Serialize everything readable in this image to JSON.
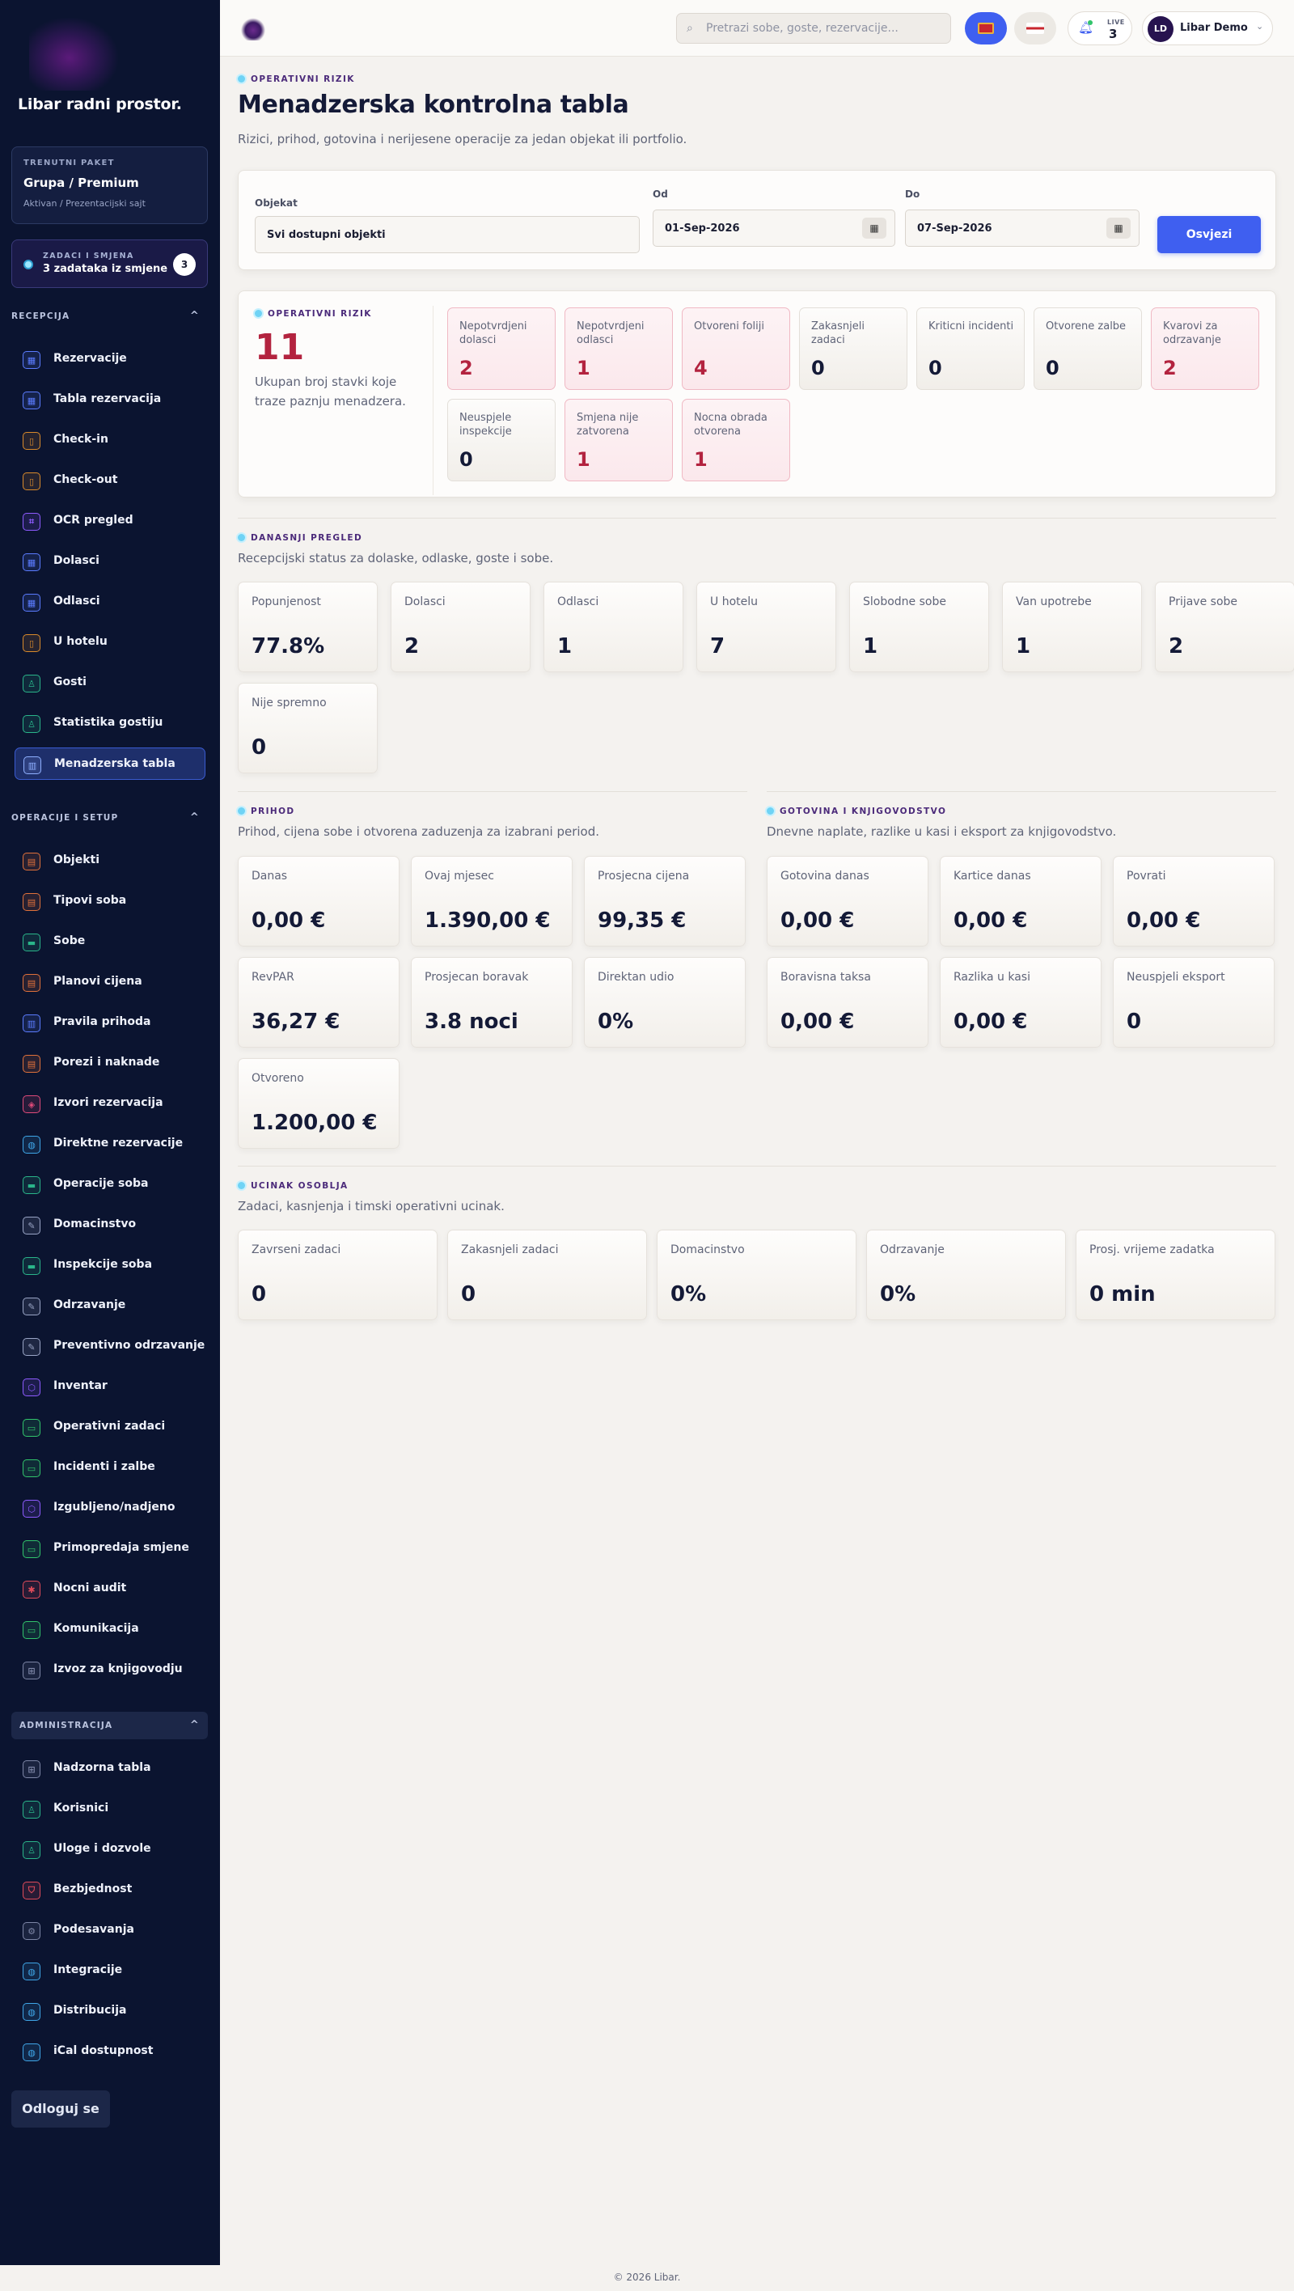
{
  "sidebar": {
    "brand": "Libar radni prostor.",
    "plan": {
      "label": "TRENUTNI PAKET",
      "name": "Grupa / Premium",
      "status": "Aktivan / Prezentacijski sajt"
    },
    "tasks": {
      "label": "ZADACI I SMJENA",
      "text": "3 zadataka iz smjene",
      "count": "3"
    },
    "sections": {
      "reception": "RECEPCIJA",
      "operations": "OPERACIJE I SETUP",
      "admin": "ADMINISTRACIJA"
    },
    "reception_items": [
      {
        "label": "Rezervacije",
        "icon": "calendar-icon",
        "color": "#5b7cff"
      },
      {
        "label": "Tabla rezervacija",
        "icon": "calendar-icon",
        "color": "#5b7cff"
      },
      {
        "label": "Check-in",
        "icon": "door-icon",
        "color": "#d98a2b"
      },
      {
        "label": "Check-out",
        "icon": "door-icon",
        "color": "#d98a2b"
      },
      {
        "label": "OCR pregled",
        "icon": "scan-icon",
        "color": "#8e5bff"
      },
      {
        "label": "Dolasci",
        "icon": "calendar-icon",
        "color": "#5b7cff"
      },
      {
        "label": "Odlasci",
        "icon": "calendar-icon",
        "color": "#5b7cff"
      },
      {
        "label": "U hotelu",
        "icon": "door-icon",
        "color": "#d98a2b"
      },
      {
        "label": "Gosti",
        "icon": "user-icon",
        "color": "#2ab58a"
      },
      {
        "label": "Statistika gostiju",
        "icon": "user-icon",
        "color": "#2ab58a"
      },
      {
        "label": "Menadzerska tabla",
        "icon": "chart-icon",
        "color": "#8fb0ff"
      }
    ],
    "operations_items": [
      {
        "label": "Objekti",
        "icon": "building-icon",
        "color": "#e0713b"
      },
      {
        "label": "Tipovi soba",
        "icon": "building-icon",
        "color": "#e0713b"
      },
      {
        "label": "Sobe",
        "icon": "bed-icon",
        "color": "#2ab58a"
      },
      {
        "label": "Planovi cijena",
        "icon": "price-icon",
        "color": "#e0713b"
      },
      {
        "label": "Pravila prihoda",
        "icon": "chart-icon",
        "color": "#5b7cff"
      },
      {
        "label": "Porezi i naknade",
        "icon": "price-icon",
        "color": "#e0713b"
      },
      {
        "label": "Izvori rezervacija",
        "icon": "tag-icon",
        "color": "#e04b7a"
      },
      {
        "label": "Direktne rezervacije",
        "icon": "globe-icon",
        "color": "#3fa6e8"
      },
      {
        "label": "Operacije soba",
        "icon": "bed-icon",
        "color": "#2ab58a"
      },
      {
        "label": "Domacinstvo",
        "icon": "brush-icon",
        "color": "#9aa5c6"
      },
      {
        "label": "Inspekcije soba",
        "icon": "bed-icon",
        "color": "#2ab58a"
      },
      {
        "label": "Odrzavanje",
        "icon": "wrench-icon",
        "color": "#9aa5c6"
      },
      {
        "label": "Preventivno odrzavanje",
        "icon": "wrench-icon",
        "color": "#9aa5c6"
      },
      {
        "label": "Inventar",
        "icon": "box-icon",
        "color": "#8e5bff"
      },
      {
        "label": "Operativni zadaci",
        "icon": "chat-icon",
        "color": "#31c46b"
      },
      {
        "label": "Incidenti i zalbe",
        "icon": "chat-icon",
        "color": "#31c46b"
      },
      {
        "label": "Izgubljeno/nadjeno",
        "icon": "box-icon",
        "color": "#8e5bff"
      },
      {
        "label": "Primopredaja smjene",
        "icon": "chat-icon",
        "color": "#31c46b"
      },
      {
        "label": "Nocni audit",
        "icon": "audit-icon",
        "color": "#e04b5a"
      },
      {
        "label": "Komunikacija",
        "icon": "chat-icon",
        "color": "#31c46b"
      },
      {
        "label": "Izvoz za knjigovodju",
        "icon": "grid-icon",
        "color": "#7d86a6"
      }
    ],
    "admin_items": [
      {
        "label": "Nadzorna tabla",
        "icon": "grid-icon",
        "color": "#7d86a6"
      },
      {
        "label": "Korisnici",
        "icon": "user-icon",
        "color": "#2ab58a"
      },
      {
        "label": "Uloge i dozvole",
        "icon": "user-icon",
        "color": "#2ab58a"
      },
      {
        "label": "Bezbjednost",
        "icon": "shield-icon",
        "color": "#e04b5a"
      },
      {
        "label": "Podesavanja",
        "icon": "gear-icon",
        "color": "#7d86a6"
      },
      {
        "label": "Integracije",
        "icon": "globe-icon",
        "color": "#3fa6e8"
      },
      {
        "label": "Distribucija",
        "icon": "globe-icon",
        "color": "#3fa6e8"
      },
      {
        "label": "iCal dostupnost",
        "icon": "globe-icon",
        "color": "#3fa6e8"
      }
    ],
    "logout": "Odloguj se"
  },
  "topbar": {
    "search_placeholder": "Pretrazi sobe, goste, rezervacije...",
    "live_label": "LIVE",
    "live_count": "3",
    "user_initials": "LD",
    "user_name": "Libar Demo"
  },
  "header": {
    "eyebrow": "OPERATIVNI RIZIK",
    "title": "Menadzerska kontrolna tabla",
    "subtitle": "Rizici, prihod, gotovina i nerijesene operacije za jedan objekat ili portfolio."
  },
  "filters": {
    "property_label": "Objekat",
    "property_value": "Svi dostupni objekti",
    "from_label": "Od",
    "from_value": "01-Sep-2026",
    "to_label": "Do",
    "to_value": "07-Sep-2026",
    "refresh": "Osvjezi"
  },
  "risk": {
    "eyebrow": "OPERATIVNI RIZIK",
    "total": "11",
    "description": "Ukupan broj stavki koje traze paznju menadzera.",
    "items": [
      {
        "label": "Nepotvrdjeni dolasci",
        "value": "2",
        "alert": true
      },
      {
        "label": "Nepotvrdjeni odlasci",
        "value": "1",
        "alert": true
      },
      {
        "label": "Otvoreni foliji",
        "value": "4",
        "alert": true
      },
      {
        "label": "Zakasnjeli zadaci",
        "value": "0",
        "alert": false
      },
      {
        "label": "Kriticni incidenti",
        "value": "0",
        "alert": false
      },
      {
        "label": "Otvorene zalbe",
        "value": "0",
        "alert": false
      },
      {
        "label": "Kvarovi za odrzavanje",
        "value": "2",
        "alert": true
      },
      {
        "label": "Neuspjele inspekcije",
        "value": "0",
        "alert": false
      },
      {
        "label": "Smjena nije zatvorena",
        "value": "1",
        "alert": true
      },
      {
        "label": "Nocna obrada otvorena",
        "value": "1",
        "alert": true
      }
    ]
  },
  "today": {
    "eyebrow": "DANASNJI PREGLED",
    "subtitle": "Recepcijski status za dolaske, odlaske, goste i sobe.",
    "stats": [
      {
        "label": "Popunjenost",
        "value": "77.8%"
      },
      {
        "label": "Dolasci",
        "value": "2"
      },
      {
        "label": "Odlasci",
        "value": "1"
      },
      {
        "label": "U hotelu",
        "value": "7"
      },
      {
        "label": "Slobodne sobe",
        "value": "1"
      },
      {
        "label": "Van upotrebe",
        "value": "1"
      },
      {
        "label": "Prijave sobe",
        "value": "2"
      },
      {
        "label": "Nije spremno",
        "value": "0"
      }
    ]
  },
  "revenue": {
    "eyebrow": "PRIHOD",
    "subtitle": "Prihod, cijena sobe i otvorena zaduzenja za izabrani period.",
    "stats": [
      {
        "label": "Danas",
        "value": "0,00 €"
      },
      {
        "label": "Ovaj mjesec",
        "value": "1.390,00 €"
      },
      {
        "label": "Prosjecna cijena",
        "value": "99,35 €"
      },
      {
        "label": "RevPAR",
        "value": "36,27 €"
      },
      {
        "label": "Prosjecan boravak",
        "value": "3.8 noci"
      },
      {
        "label": "Direktan udio",
        "value": "0%"
      },
      {
        "label": "Otvoreno",
        "value": "1.200,00 €"
      }
    ]
  },
  "cash": {
    "eyebrow": "GOTOVINA I KNJIGOVODSTVO",
    "subtitle": "Dnevne naplate, razlike u kasi i eksport za knjigovodstvo.",
    "stats": [
      {
        "label": "Gotovina danas",
        "value": "0,00 €"
      },
      {
        "label": "Kartice danas",
        "value": "0,00 €"
      },
      {
        "label": "Povrati",
        "value": "0,00 €"
      },
      {
        "label": "Boravisna taksa",
        "value": "0,00 €"
      },
      {
        "label": "Razlika u kasi",
        "value": "0,00 €"
      },
      {
        "label": "Neuspjeli eksport",
        "value": "0"
      }
    ]
  },
  "staff": {
    "eyebrow": "UCINAK OSOBLJA",
    "subtitle": "Zadaci, kasnjenja i timski operativni ucinak.",
    "stats": [
      {
        "label": "Zavrseni zadaci",
        "value": "0"
      },
      {
        "label": "Zakasnjeli zadaci",
        "value": "0"
      },
      {
        "label": "Domacinstvo",
        "value": "0%"
      },
      {
        "label": "Odrzavanje",
        "value": "0%"
      },
      {
        "label": "Prosj. vrijeme zadatka",
        "value": "0 min"
      }
    ]
  },
  "footer": "© 2026 Libar."
}
